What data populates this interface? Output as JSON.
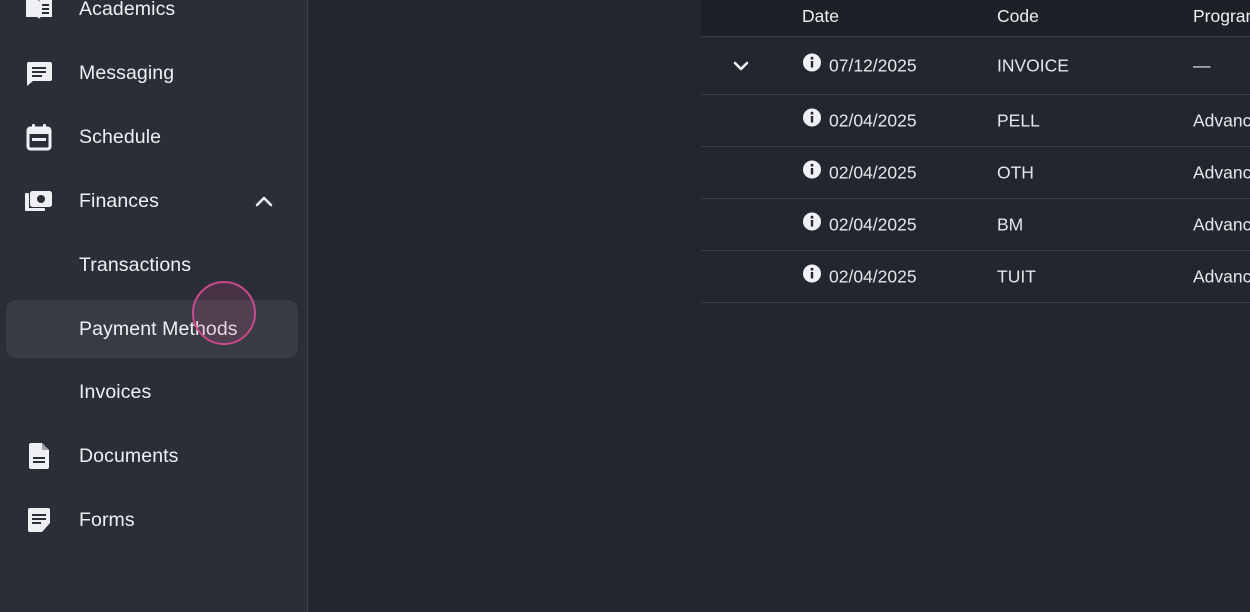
{
  "sidebar": {
    "items": [
      {
        "id": "academics",
        "label": "Academics",
        "icon": "book-icon"
      },
      {
        "id": "messaging",
        "label": "Messaging",
        "icon": "message-icon"
      },
      {
        "id": "schedule",
        "label": "Schedule",
        "icon": "calendar-icon"
      },
      {
        "id": "finances",
        "label": "Finances",
        "icon": "wallet-icon",
        "expanded": true
      },
      {
        "id": "transactions",
        "label": "Transactions"
      },
      {
        "id": "payment-methods",
        "label": "Payment Methods",
        "selected": true
      },
      {
        "id": "invoices",
        "label": "Invoices"
      },
      {
        "id": "documents",
        "label": "Documents",
        "icon": "document-icon"
      },
      {
        "id": "forms",
        "label": "Forms",
        "icon": "form-icon"
      }
    ]
  },
  "table": {
    "columns": [
      "Date",
      "Code",
      "Program"
    ],
    "rows": [
      {
        "date": "07/12/2025",
        "code": "INVOICE",
        "program": "—",
        "expandable": true
      },
      {
        "date": "02/04/2025",
        "code": "PELL",
        "program": "Advanced"
      },
      {
        "date": "02/04/2025",
        "code": "OTH",
        "program": "Advanced"
      },
      {
        "date": "02/04/2025",
        "code": "BM",
        "program": "Advanced"
      },
      {
        "date": "02/04/2025",
        "code": "TUIT",
        "program": "Advanced"
      }
    ]
  },
  "colors": {
    "sidebar_bg": "#2b2e36",
    "main_bg": "#23262e",
    "header_bg": "#1e2027",
    "selected_bg": "#383b43",
    "ripple": "#c84b8b",
    "divider": "#3a3d45",
    "text": "#eef0f3"
  }
}
